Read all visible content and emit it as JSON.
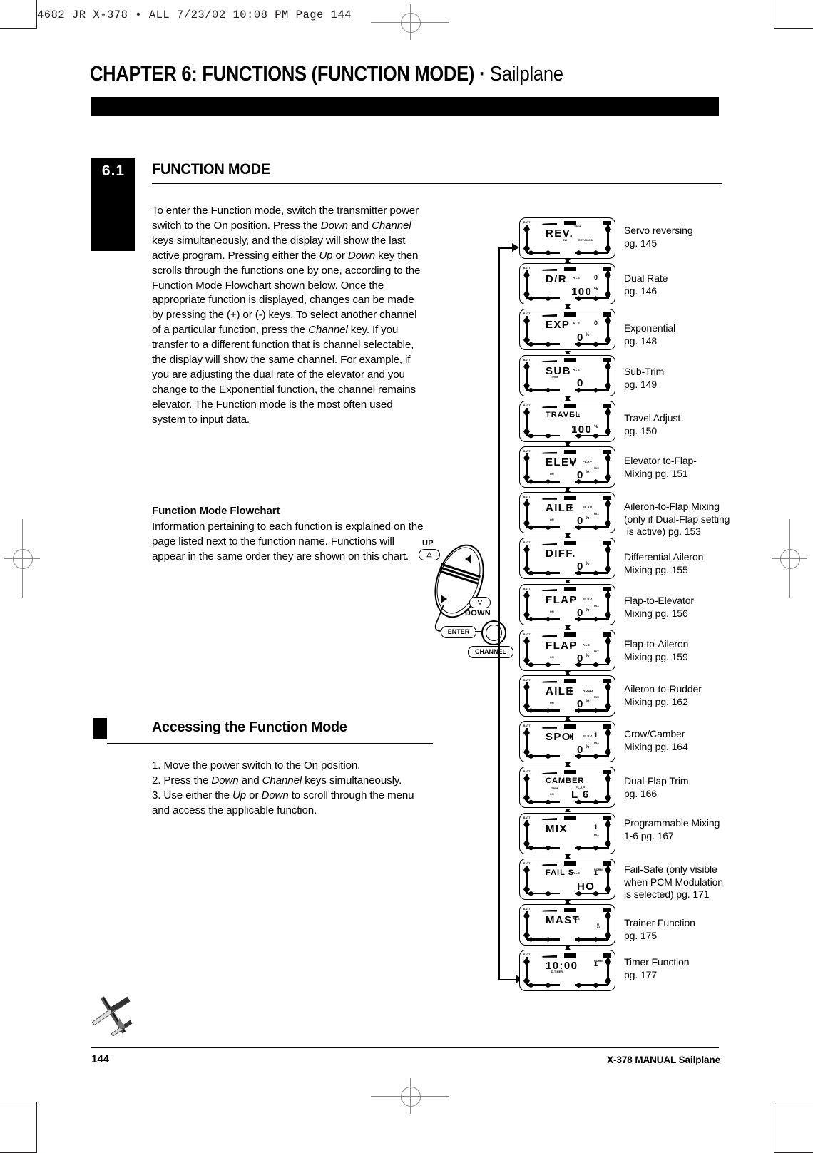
{
  "slug": "4682 JR X-378 • ALL  7/23/02  10:08 PM  Page 144",
  "chapter": {
    "title_bold": "CHAPTER 6: FUNCTIONS (FUNCTION MODE)",
    "title_sep": " · ",
    "title_light": "Sailplane"
  },
  "section": {
    "number": "6.1",
    "heading": "FUNCTION MODE",
    "paragraph_1": "To enter the Function mode, switch the transmitter power switch to the On position. Press the <i>Down</i> and <i>Channel</i> keys simultaneously, and the display will show the last active program. Pressing either the <i>Up</i> or <i>Down</i> key then scrolls through the functions one by one, according to the Function Mode Flowchart shown below. Once the appropriate function is displayed, changes can be made by pressing the (+) or (-) keys. To select another channel of a particular function, press the <i>Channel</i> key. If you transfer to a different function that is channel selectable, the display will show the same channel. For example, if you are adjusting the dual rate of the elevator and you change to the Exponential function, the channel remains elevator. The Function mode is the most often used system to input data.",
    "flowchart_heading": "Function Mode Flowchart",
    "paragraph_2": "Information pertaining to each function is explained on the page listed next to the function name. Functions will appear in the same order they are shown on this chart."
  },
  "accessing": {
    "heading": "Accessing the Function Mode",
    "steps": "1. Move the power switch to the On position.<br>2. Press the <i>Down</i> and <i>Channel</i> keys simultaneously.<br>3. Use either the <i>Up</i> or <i>Down</i> to scroll through the menu and access the applicable function."
  },
  "keypad": {
    "up_label": "UP",
    "up_glyph": "△",
    "down_label": "DOWN",
    "down_glyph": "▽",
    "enter_label": "ENTER",
    "channel_label": "CHANNEL"
  },
  "flowchart": {
    "screens": [
      {
        "main": "REV.",
        "ch": "",
        "tm": "TRIM",
        "sub": "SW",
        "sub2": "REV-NORM",
        "value": "",
        "unit": "",
        "pos": ""
      },
      {
        "main": "D/R",
        "ch": "ALE",
        "value": "100",
        "unit": "%",
        "pos": "0"
      },
      {
        "main": "EXP",
        "ch": "ALE",
        "value": "0",
        "unit": "%",
        "pos": "0"
      },
      {
        "main": "SUB",
        "main2": "TRIM",
        "ch": "ALE",
        "value": "0",
        "unit": ""
      },
      {
        "main": "TRAVEL",
        "ch": "ALE",
        "value": "100",
        "unit": "%"
      },
      {
        "main": "ELEV",
        "arrow": true,
        "tgt": "FLAP",
        "on": "ON",
        "mix": "MIX",
        "value": "0",
        "unit": "%"
      },
      {
        "main": "AILE",
        "arrow": true,
        "tgt": "FLAP",
        "on": "ON",
        "mix": "MIX",
        "value": "0",
        "unit": "%"
      },
      {
        "main": "DIFF.",
        "value": "0",
        "unit": "%"
      },
      {
        "main": "FLAP",
        "arrow": true,
        "tgt": "ELEV",
        "on": "ON",
        "mix": "MIX",
        "value": "0",
        "unit": "%"
      },
      {
        "main": "FLAP",
        "arrow": true,
        "tgt": "ALE",
        "on": "ON",
        "mix": "MIX",
        "value": "0",
        "unit": "%"
      },
      {
        "main": "AILE",
        "arrow": true,
        "tgt": "RUDD",
        "on": "ON",
        "mix": "MIX",
        "value": "0",
        "unit": "%"
      },
      {
        "main": "SPOI",
        "arrow": true,
        "tgt": "ELEV",
        "mix": "MIX",
        "value": "0",
        "unit": "%",
        "pos": "1"
      },
      {
        "main": "CAMBER",
        "main2": "TRIM",
        "tgt": "FLAP",
        "on": "ON",
        "value": "L 6",
        "unit": ""
      },
      {
        "main": "MIX",
        "mix": "MIX",
        "pos": "1"
      },
      {
        "main": "FAIL S",
        "ch": "ALE",
        "mod": "NORM",
        "value": "HO",
        "unit": "",
        "pos": "1"
      },
      {
        "main": "MAST",
        "ch": "ALE",
        "value": "",
        "unit": "",
        "side": "M\nPB"
      },
      {
        "main": "10:00",
        "main2": "D.TIMER",
        "mod": "NORM",
        "pos": "1"
      }
    ]
  },
  "labels": [
    {
      "text": "Servo reversing<br>pg. 145"
    },
    {
      "text": "Dual Rate<br>pg. 146"
    },
    {
      "text": "Exponential<br>pg. 148"
    },
    {
      "text": "Sub-Trim<br>pg. 149"
    },
    {
      "text": "Travel Adjust<br>pg. 150"
    },
    {
      "text": "Elevator to-Flap-<br>Mixing pg. 151"
    },
    {
      "text": "Aileron-to-Flap Mixing<br>(only if Dual-Flap setting<br>&nbsp;is active) pg. 153"
    },
    {
      "text": "Differential Aileron<br>Mixing pg. 155"
    },
    {
      "text": "Flap-to-Elevator<br>Mixing pg. 156"
    },
    {
      "text": "Flap-to-Aileron<br>Mixing pg. 159"
    },
    {
      "text": "Aileron-to-Rudder<br>Mixing pg. 162"
    },
    {
      "text": "Crow/Camber<br>Mixing pg. 164"
    },
    {
      "text": "Dual-Flap Trim<br>pg. 166"
    },
    {
      "text": "Programmable Mixing<br>1-6 pg. 167"
    },
    {
      "text": "Fail-Safe (only visible<br>when PCM Modulation<br>is selected) pg. 171"
    },
    {
      "text": "Trainer Function<br>pg. 175"
    },
    {
      "text": "Timer Function<br>pg. 177"
    }
  ],
  "footer": {
    "page": "144",
    "manual": "X-378 MANUAL  Sailplane"
  }
}
